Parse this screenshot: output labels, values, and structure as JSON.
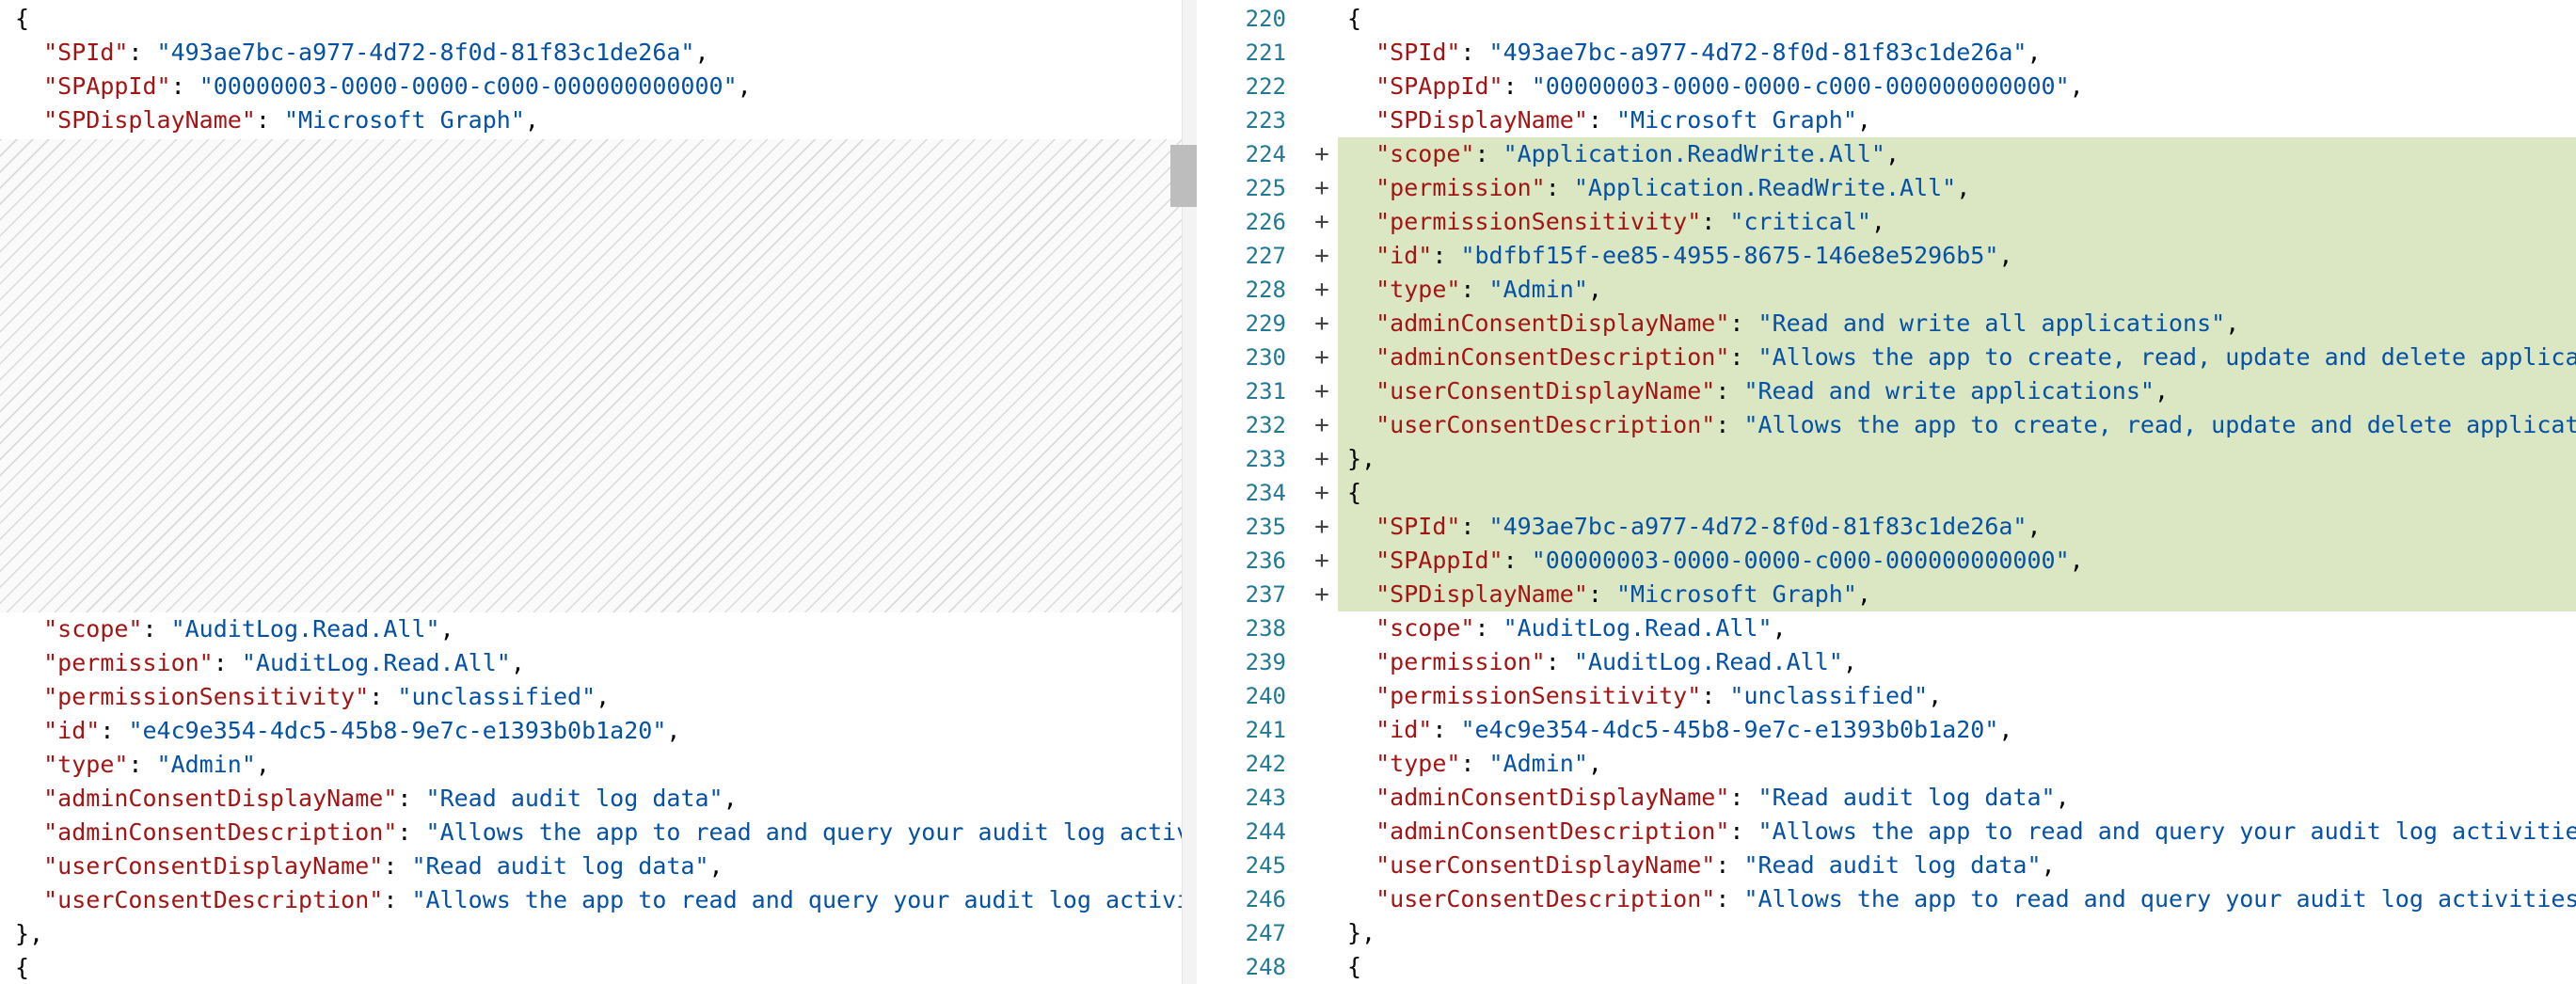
{
  "left_pane": {
    "lines_top": [
      [
        {
          "t": "{",
          "c": "p"
        }
      ],
      [
        {
          "t": "  ",
          "c": "p"
        },
        {
          "t": "\"SPId\"",
          "c": "k"
        },
        {
          "t": ": ",
          "c": "p"
        },
        {
          "t": "\"493ae7bc-a977-4d72-8f0d-81f83c1de26a\"",
          "c": "s"
        },
        {
          "t": ",",
          "c": "p"
        }
      ],
      [
        {
          "t": "  ",
          "c": "p"
        },
        {
          "t": "\"SPAppId\"",
          "c": "k"
        },
        {
          "t": ": ",
          "c": "p"
        },
        {
          "t": "\"00000003-0000-0000-c000-000000000000\"",
          "c": "s"
        },
        {
          "t": ",",
          "c": "p"
        }
      ],
      [
        {
          "t": "  ",
          "c": "p"
        },
        {
          "t": "\"SPDisplayName\"",
          "c": "k"
        },
        {
          "t": ": ",
          "c": "p"
        },
        {
          "t": "\"Microsoft Graph\"",
          "c": "s"
        },
        {
          "t": ",",
          "c": "p"
        }
      ]
    ],
    "lines_bottom": [
      [
        {
          "t": "  ",
          "c": "p"
        },
        {
          "t": "\"scope\"",
          "c": "k"
        },
        {
          "t": ": ",
          "c": "p"
        },
        {
          "t": "\"AuditLog.Read.All\"",
          "c": "s"
        },
        {
          "t": ",",
          "c": "p"
        }
      ],
      [
        {
          "t": "  ",
          "c": "p"
        },
        {
          "t": "\"permission\"",
          "c": "k"
        },
        {
          "t": ": ",
          "c": "p"
        },
        {
          "t": "\"AuditLog.Read.All\"",
          "c": "s"
        },
        {
          "t": ",",
          "c": "p"
        }
      ],
      [
        {
          "t": "  ",
          "c": "p"
        },
        {
          "t": "\"permissionSensitivity\"",
          "c": "k"
        },
        {
          "t": ": ",
          "c": "p"
        },
        {
          "t": "\"unclassified\"",
          "c": "s"
        },
        {
          "t": ",",
          "c": "p"
        }
      ],
      [
        {
          "t": "  ",
          "c": "p"
        },
        {
          "t": "\"id\"",
          "c": "k"
        },
        {
          "t": ": ",
          "c": "p"
        },
        {
          "t": "\"e4c9e354-4dc5-45b8-9e7c-e1393b0b1a20\"",
          "c": "s"
        },
        {
          "t": ",",
          "c": "p"
        }
      ],
      [
        {
          "t": "  ",
          "c": "p"
        },
        {
          "t": "\"type\"",
          "c": "k"
        },
        {
          "t": ": ",
          "c": "p"
        },
        {
          "t": "\"Admin\"",
          "c": "s"
        },
        {
          "t": ",",
          "c": "p"
        }
      ],
      [
        {
          "t": "  ",
          "c": "p"
        },
        {
          "t": "\"adminConsentDisplayName\"",
          "c": "k"
        },
        {
          "t": ": ",
          "c": "p"
        },
        {
          "t": "\"Read audit log data\"",
          "c": "s"
        },
        {
          "t": ",",
          "c": "p"
        }
      ],
      [
        {
          "t": "  ",
          "c": "p"
        },
        {
          "t": "\"adminConsentDescription\"",
          "c": "k"
        },
        {
          "t": ": ",
          "c": "p"
        },
        {
          "t": "\"Allows the app to read and query your audit log activitie",
          "c": "s"
        }
      ],
      [
        {
          "t": "  ",
          "c": "p"
        },
        {
          "t": "\"userConsentDisplayName\"",
          "c": "k"
        },
        {
          "t": ": ",
          "c": "p"
        },
        {
          "t": "\"Read audit log data\"",
          "c": "s"
        },
        {
          "t": ",",
          "c": "p"
        }
      ],
      [
        {
          "t": "  ",
          "c": "p"
        },
        {
          "t": "\"userConsentDescription\"",
          "c": "k"
        },
        {
          "t": ": ",
          "c": "p"
        },
        {
          "t": "\"Allows the app to read and query your audit log activities",
          "c": "s"
        }
      ],
      [
        {
          "t": "},",
          "c": "p"
        }
      ],
      [
        {
          "t": "{",
          "c": "p"
        }
      ]
    ]
  },
  "right_pane": {
    "lines": [
      {
        "num": "220",
        "marker": "",
        "added": false,
        "parts": [
          {
            "t": "{",
            "c": "p"
          }
        ]
      },
      {
        "num": "221",
        "marker": "",
        "added": false,
        "parts": [
          {
            "t": "  ",
            "c": "p"
          },
          {
            "t": "\"SPId\"",
            "c": "k"
          },
          {
            "t": ": ",
            "c": "p"
          },
          {
            "t": "\"493ae7bc-a977-4d72-8f0d-81f83c1de26a\"",
            "c": "s"
          },
          {
            "t": ",",
            "c": "p"
          }
        ]
      },
      {
        "num": "222",
        "marker": "",
        "added": false,
        "parts": [
          {
            "t": "  ",
            "c": "p"
          },
          {
            "t": "\"SPAppId\"",
            "c": "k"
          },
          {
            "t": ": ",
            "c": "p"
          },
          {
            "t": "\"00000003-0000-0000-c000-000000000000\"",
            "c": "s"
          },
          {
            "t": ",",
            "c": "p"
          }
        ]
      },
      {
        "num": "223",
        "marker": "",
        "added": false,
        "parts": [
          {
            "t": "  ",
            "c": "p"
          },
          {
            "t": "\"SPDisplayName\"",
            "c": "k"
          },
          {
            "t": ": ",
            "c": "p"
          },
          {
            "t": "\"Microsoft Graph\"",
            "c": "s"
          },
          {
            "t": ",",
            "c": "p"
          }
        ]
      },
      {
        "num": "224",
        "marker": "+",
        "added": true,
        "parts": [
          {
            "t": "  ",
            "c": "p"
          },
          {
            "t": "\"scope\"",
            "c": "k"
          },
          {
            "t": ": ",
            "c": "p"
          },
          {
            "t": "\"Application.ReadWrite.All\"",
            "c": "s"
          },
          {
            "t": ",",
            "c": "p"
          }
        ]
      },
      {
        "num": "225",
        "marker": "+",
        "added": true,
        "parts": [
          {
            "t": "  ",
            "c": "p"
          },
          {
            "t": "\"permission\"",
            "c": "k"
          },
          {
            "t": ": ",
            "c": "p"
          },
          {
            "t": "\"Application.ReadWrite.All\"",
            "c": "s"
          },
          {
            "t": ",",
            "c": "p"
          }
        ]
      },
      {
        "num": "226",
        "marker": "+",
        "added": true,
        "parts": [
          {
            "t": "  ",
            "c": "p"
          },
          {
            "t": "\"permissionSensitivity\"",
            "c": "k"
          },
          {
            "t": ": ",
            "c": "p"
          },
          {
            "t": "\"critical\"",
            "c": "s"
          },
          {
            "t": ",",
            "c": "p"
          }
        ]
      },
      {
        "num": "227",
        "marker": "+",
        "added": true,
        "parts": [
          {
            "t": "  ",
            "c": "p"
          },
          {
            "t": "\"id\"",
            "c": "k"
          },
          {
            "t": ": ",
            "c": "p"
          },
          {
            "t": "\"bdfbf15f-ee85-4955-8675-146e8e5296b5\"",
            "c": "s"
          },
          {
            "t": ",",
            "c": "p"
          }
        ]
      },
      {
        "num": "228",
        "marker": "+",
        "added": true,
        "parts": [
          {
            "t": "  ",
            "c": "p"
          },
          {
            "t": "\"type\"",
            "c": "k"
          },
          {
            "t": ": ",
            "c": "p"
          },
          {
            "t": "\"Admin\"",
            "c": "s"
          },
          {
            "t": ",",
            "c": "p"
          }
        ]
      },
      {
        "num": "229",
        "marker": "+",
        "added": true,
        "parts": [
          {
            "t": "  ",
            "c": "p"
          },
          {
            "t": "\"adminConsentDisplayName\"",
            "c": "k"
          },
          {
            "t": ": ",
            "c": "p"
          },
          {
            "t": "\"Read and write all applications\"",
            "c": "s"
          },
          {
            "t": ",",
            "c": "p"
          }
        ]
      },
      {
        "num": "230",
        "marker": "+",
        "added": true,
        "parts": [
          {
            "t": "  ",
            "c": "p"
          },
          {
            "t": "\"adminConsentDescription\"",
            "c": "k"
          },
          {
            "t": ": ",
            "c": "p"
          },
          {
            "t": "\"Allows the app to create, read, update and delete applica",
            "c": "s"
          }
        ]
      },
      {
        "num": "231",
        "marker": "+",
        "added": true,
        "parts": [
          {
            "t": "  ",
            "c": "p"
          },
          {
            "t": "\"userConsentDisplayName\"",
            "c": "k"
          },
          {
            "t": ": ",
            "c": "p"
          },
          {
            "t": "\"Read and write applications\"",
            "c": "s"
          },
          {
            "t": ",",
            "c": "p"
          }
        ]
      },
      {
        "num": "232",
        "marker": "+",
        "added": true,
        "parts": [
          {
            "t": "  ",
            "c": "p"
          },
          {
            "t": "\"userConsentDescription\"",
            "c": "k"
          },
          {
            "t": ": ",
            "c": "p"
          },
          {
            "t": "\"Allows the app to create, read, update and delete applicat",
            "c": "s"
          }
        ]
      },
      {
        "num": "233",
        "marker": "+",
        "added": true,
        "parts": [
          {
            "t": "},",
            "c": "p"
          }
        ]
      },
      {
        "num": "234",
        "marker": "+",
        "added": true,
        "parts": [
          {
            "t": "{",
            "c": "p"
          }
        ]
      },
      {
        "num": "235",
        "marker": "+",
        "added": true,
        "parts": [
          {
            "t": "  ",
            "c": "p"
          },
          {
            "t": "\"SPId\"",
            "c": "k"
          },
          {
            "t": ": ",
            "c": "p"
          },
          {
            "t": "\"493ae7bc-a977-4d72-8f0d-81f83c1de26a\"",
            "c": "s"
          },
          {
            "t": ",",
            "c": "p"
          }
        ]
      },
      {
        "num": "236",
        "marker": "+",
        "added": true,
        "parts": [
          {
            "t": "  ",
            "c": "p"
          },
          {
            "t": "\"SPAppId\"",
            "c": "k"
          },
          {
            "t": ": ",
            "c": "p"
          },
          {
            "t": "\"00000003-0000-0000-c000-000000000000\"",
            "c": "s"
          },
          {
            "t": ",",
            "c": "p"
          }
        ]
      },
      {
        "num": "237",
        "marker": "+",
        "added": true,
        "parts": [
          {
            "t": "  ",
            "c": "p"
          },
          {
            "t": "\"SPDisplayName\"",
            "c": "k"
          },
          {
            "t": ": ",
            "c": "p"
          },
          {
            "t": "\"Microsoft Graph\"",
            "c": "s"
          },
          {
            "t": ",",
            "c": "p"
          }
        ]
      },
      {
        "num": "238",
        "marker": "",
        "added": false,
        "parts": [
          {
            "t": "  ",
            "c": "p"
          },
          {
            "t": "\"scope\"",
            "c": "k"
          },
          {
            "t": ": ",
            "c": "p"
          },
          {
            "t": "\"AuditLog.Read.All\"",
            "c": "s"
          },
          {
            "t": ",",
            "c": "p"
          }
        ]
      },
      {
        "num": "239",
        "marker": "",
        "added": false,
        "parts": [
          {
            "t": "  ",
            "c": "p"
          },
          {
            "t": "\"permission\"",
            "c": "k"
          },
          {
            "t": ": ",
            "c": "p"
          },
          {
            "t": "\"AuditLog.Read.All\"",
            "c": "s"
          },
          {
            "t": ",",
            "c": "p"
          }
        ]
      },
      {
        "num": "240",
        "marker": "",
        "added": false,
        "parts": [
          {
            "t": "  ",
            "c": "p"
          },
          {
            "t": "\"permissionSensitivity\"",
            "c": "k"
          },
          {
            "t": ": ",
            "c": "p"
          },
          {
            "t": "\"unclassified\"",
            "c": "s"
          },
          {
            "t": ",",
            "c": "p"
          }
        ]
      },
      {
        "num": "241",
        "marker": "",
        "added": false,
        "parts": [
          {
            "t": "  ",
            "c": "p"
          },
          {
            "t": "\"id\"",
            "c": "k"
          },
          {
            "t": ": ",
            "c": "p"
          },
          {
            "t": "\"e4c9e354-4dc5-45b8-9e7c-e1393b0b1a20\"",
            "c": "s"
          },
          {
            "t": ",",
            "c": "p"
          }
        ]
      },
      {
        "num": "242",
        "marker": "",
        "added": false,
        "parts": [
          {
            "t": "  ",
            "c": "p"
          },
          {
            "t": "\"type\"",
            "c": "k"
          },
          {
            "t": ": ",
            "c": "p"
          },
          {
            "t": "\"Admin\"",
            "c": "s"
          },
          {
            "t": ",",
            "c": "p"
          }
        ]
      },
      {
        "num": "243",
        "marker": "",
        "added": false,
        "parts": [
          {
            "t": "  ",
            "c": "p"
          },
          {
            "t": "\"adminConsentDisplayName\"",
            "c": "k"
          },
          {
            "t": ": ",
            "c": "p"
          },
          {
            "t": "\"Read audit log data\"",
            "c": "s"
          },
          {
            "t": ",",
            "c": "p"
          }
        ]
      },
      {
        "num": "244",
        "marker": "",
        "added": false,
        "parts": [
          {
            "t": "  ",
            "c": "p"
          },
          {
            "t": "\"adminConsentDescription\"",
            "c": "k"
          },
          {
            "t": ": ",
            "c": "p"
          },
          {
            "t": "\"Allows the app to read and query your audit log activitie",
            "c": "s"
          }
        ]
      },
      {
        "num": "245",
        "marker": "",
        "added": false,
        "parts": [
          {
            "t": "  ",
            "c": "p"
          },
          {
            "t": "\"userConsentDisplayName\"",
            "c": "k"
          },
          {
            "t": ": ",
            "c": "p"
          },
          {
            "t": "\"Read audit log data\"",
            "c": "s"
          },
          {
            "t": ",",
            "c": "p"
          }
        ]
      },
      {
        "num": "246",
        "marker": "",
        "added": false,
        "parts": [
          {
            "t": "  ",
            "c": "p"
          },
          {
            "t": "\"userConsentDescription\"",
            "c": "k"
          },
          {
            "t": ": ",
            "c": "p"
          },
          {
            "t": "\"Allows the app to read and query your audit log activities",
            "c": "s"
          }
        ]
      },
      {
        "num": "247",
        "marker": "",
        "added": false,
        "parts": [
          {
            "t": "},",
            "c": "p"
          }
        ]
      },
      {
        "num": "248",
        "marker": "",
        "added": false,
        "parts": [
          {
            "t": "{",
            "c": "p"
          }
        ]
      }
    ]
  },
  "colors": {
    "json_key": "#a31515",
    "json_string": "#0451a5",
    "line_number": "#237893",
    "added_background": "#dbe6c3"
  },
  "icons": {
    "added_marker": "plus-icon",
    "removed_region": "diagonal-hatch"
  }
}
